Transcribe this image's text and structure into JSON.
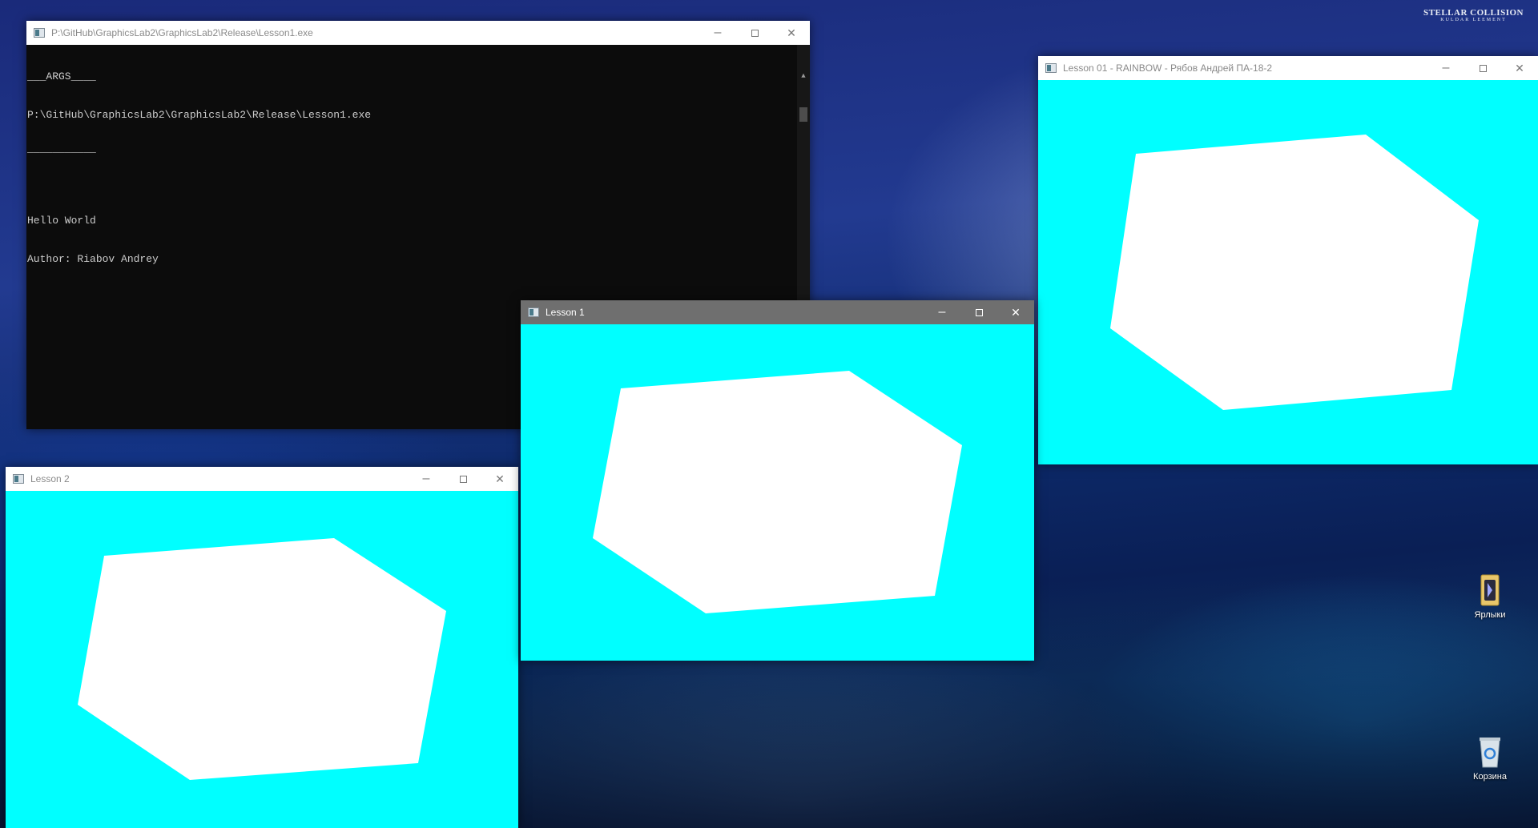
{
  "desktop": {
    "watermark_line1": "STELLAR COLLISION",
    "watermark_line2": "KULDAR LEEMENT",
    "icons": [
      {
        "label": "Ярлыки",
        "icon": "shortcuts-folder-icon"
      },
      {
        "label": "Корзина",
        "icon": "recycle-bin-icon"
      }
    ]
  },
  "console_window": {
    "title": "P:\\GitHub\\GraphicsLab2\\GraphicsLab2\\Release\\Lesson1.exe",
    "lines": [
      "___ARGS____",
      "P:\\GitHub\\GraphicsLab2\\GraphicsLab2\\Release\\Lesson1.exe",
      "___________",
      "",
      "Hello World",
      "Author: Riabov Andrey"
    ],
    "background": "#0c0c0c",
    "text_color": "#cccccc"
  },
  "rainbow_window": {
    "title": "Lesson 01 - RAINBOW - Рябов Андрей ПА-18-2"
  },
  "lesson1_window": {
    "title": "Lesson 1"
  },
  "lesson2_window": {
    "title": "Lesson 2"
  },
  "canvas": {
    "clear_color": "#00ffff",
    "shape_color": "#ffffff"
  },
  "window_buttons": {
    "minimize": "–",
    "maximize": "□",
    "close": "✕"
  }
}
